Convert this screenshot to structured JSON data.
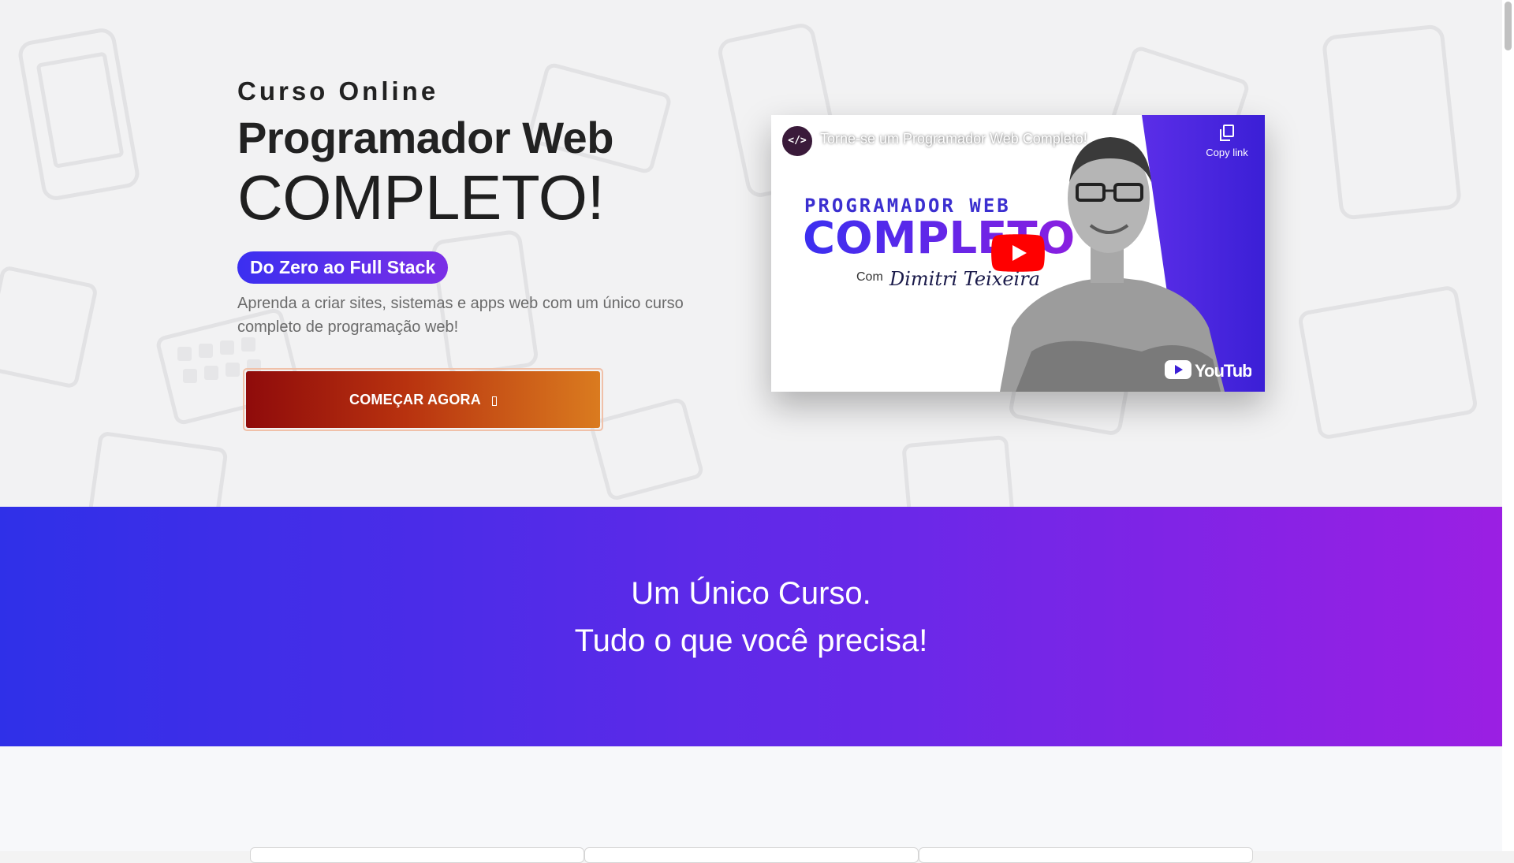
{
  "hero": {
    "eyebrow": "Curso Online",
    "headline": "Programador Web",
    "headline_big": "COMPLETO!",
    "badge": "Do Zero ao Full Stack",
    "lead": "Aprenda a criar sites, sistemas e apps web com um único curso completo de programação web!",
    "cta_label": "COMEÇAR AGORA",
    "colors": {
      "badge_start": "#3b2ff0",
      "badge_end": "#7b2fe6",
      "cta_start": "#8f0b0b",
      "cta_end": "#da7b1f"
    }
  },
  "video": {
    "title": "Torne-se um Programador Web Completo!",
    "channel_icon": "</>",
    "copy_link": "Copy link",
    "thumb_line1": "PROGRAMADOR WEB",
    "thumb_line2": "COMPLETO",
    "thumb_com": "Com",
    "thumb_signature": "Dimitri Teixeira",
    "youtube_logo": "YouTube",
    "icons": [
      "channel-avatar-icon",
      "copy-link-icon",
      "play-button-icon",
      "youtube-logo-icon"
    ]
  },
  "banner": {
    "line1": "Um Único Curso.",
    "line2": "Tudo o que você precisa!",
    "colors": {
      "start": "#2f30e8",
      "end": "#9b1fe3"
    }
  }
}
